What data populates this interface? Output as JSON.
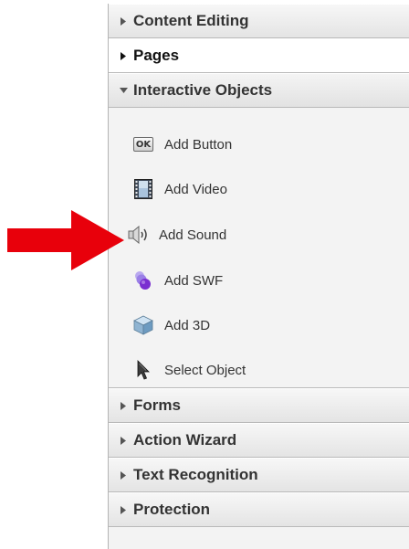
{
  "panel": {
    "sections_top": [
      {
        "label": "Content Editing",
        "state": "collapsed"
      },
      {
        "label": "Pages",
        "state": "collapsed"
      },
      {
        "label": "Interactive Objects",
        "state": "expanded"
      }
    ],
    "interactive_items": [
      {
        "label": "Add Button",
        "icon": "ok-button-icon"
      },
      {
        "label": "Add Video",
        "icon": "film-icon"
      },
      {
        "label": "Add Sound",
        "icon": "speaker-icon"
      },
      {
        "label": "Add SWF",
        "icon": "swf-bubbles-icon"
      },
      {
        "label": "Add 3D",
        "icon": "cube-icon"
      },
      {
        "label": "Select Object",
        "icon": "cursor-arrow-icon"
      }
    ],
    "sections_bottom": [
      {
        "label": "Forms",
        "state": "collapsed"
      },
      {
        "label": "Action Wizard",
        "state": "collapsed"
      },
      {
        "label": "Text Recognition",
        "state": "collapsed"
      },
      {
        "label": "Protection",
        "state": "collapsed"
      }
    ],
    "ok_badge_text": "OK"
  },
  "annotation": {
    "arrow_color": "#e8000b",
    "points_to": "Add Sound"
  }
}
